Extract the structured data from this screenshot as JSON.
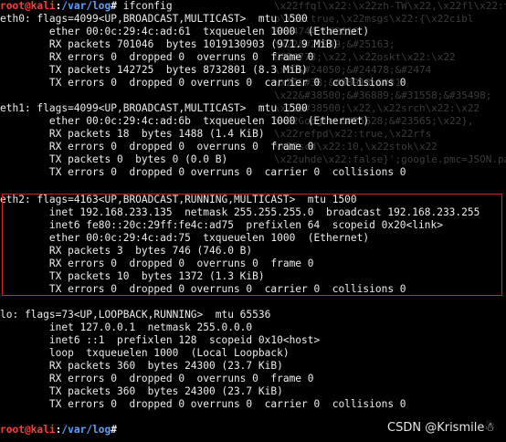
{
  "terminal": {
    "top_prompt": {
      "user": "root@kali",
      "sep": ":",
      "path": "/var/log",
      "sym": "#",
      "command": " ifconfig"
    },
    "bottom_prompt": {
      "user": "root@kali",
      "sep": ":",
      "path": "/var/log",
      "sym": "#",
      "command": " "
    }
  },
  "interfaces": {
    "eth0": [
      "eth0: flags=4099<UP,BROADCAST,MULTICAST>  mtu 1500",
      "        ether 00:0c:29:4c:ad:61  txqueuelen 1000  (Ethernet)",
      "        RX packets 701046  bytes 1019130903 (971.9 MiB)",
      "        RX errors 0  dropped 0  overruns 0  frame 0",
      "        TX packets 142725  bytes 8732801 (8.3 MiB)",
      "        TX errors 0  dropped 0 overruns 0  carrier 0  collisions 0"
    ],
    "eth1": [
      "eth1: flags=4099<UP,BROADCAST,MULTICAST>  mtu 1500",
      "        ether 00:0c:29:4c:ad:6b  txqueuelen 1000  (Ethernet)",
      "        RX packets 18  bytes 1488 (1.4 KiB)",
      "        RX errors 0  dropped 0  overruns 0  frame 0",
      "        TX packets 0  bytes 0 (0.0 B)",
      "        TX errors 0  dropped 0 overruns 0  carrier 0  collisions 0"
    ],
    "eth2": [
      "eth2: flags=4163<UP,BROADCAST,RUNNING,MULTICAST>  mtu 1500",
      "        inet 192.168.233.135  netmask 255.255.255.0  broadcast 192.168.233.255",
      "        inet6 fe80::20c:29ff:fe4c:ad75  prefixlen 64  scopeid 0x20<link>",
      "        ether 00:0c:29:4c:ad:75  txqueuelen 1000  (Ethernet)",
      "        RX packets 3  bytes 746 (746.0 B)",
      "        RX errors 0  dropped 0  overruns 0  frame 0",
      "        TX packets 10  bytes 1372 (1.3 KiB)",
      "        TX errors 0  dropped 0 overruns 0  carrier 0  collisions 0"
    ],
    "lo": [
      "lo: flags=73<UP,LOOPBACK,RUNNING>  mtu 65536",
      "        inet 127.0.0.1  netmask 255.0.0.0",
      "        inet6 ::1  prefixlen 128  scopeid 0x10<host>",
      "        loop  txqueuelen 1000  (Local Loopback)",
      "        RX packets 360  bytes 24300 (23.7 KiB)",
      "        RX errors 0  dropped 0  overruns 0  frame 0",
      "        TX packets 360  bytes 24300 (23.7 KiB)",
      "        TX errors 0  dropped 0 overruns 0  carrier 0  collisions 0"
    ]
  },
  "background_noise": [
    "\\x22ffql\\x22:\\x22zh-TW\\x22,\\x22fl\\x22:true,\\x22fl",
    "p\\x22:true,\\x22msgs\\x22:{\\x22cibl",
    "&#24744;&#2616",
    "\\x22&#22909;&#25163;",
    "&#24773;\\x22,\\x22oskt\\x22:\\x22",
    "\\x22&#24050;&#24478;&#2474",
    "\\x22&#38;&#38913;&#31",
    "\\x22&#38500;&#36889;&#31558;&#35498;",
    "\\x22&#38500;\\x22,\\x22srch\\x22:\\x22",
    "\\x22Google &#25628;&#23565;\\x22},",
    "\\x22refpd\\x22:true,\\x22rfs",
    "\\x22scd\\x22:10,\\x22stok\\x22",
    "\\x22uhde\\x22:false}';google.pmc=JSON.pars"
  ],
  "watermark": "CSDN @Krismile☃"
}
